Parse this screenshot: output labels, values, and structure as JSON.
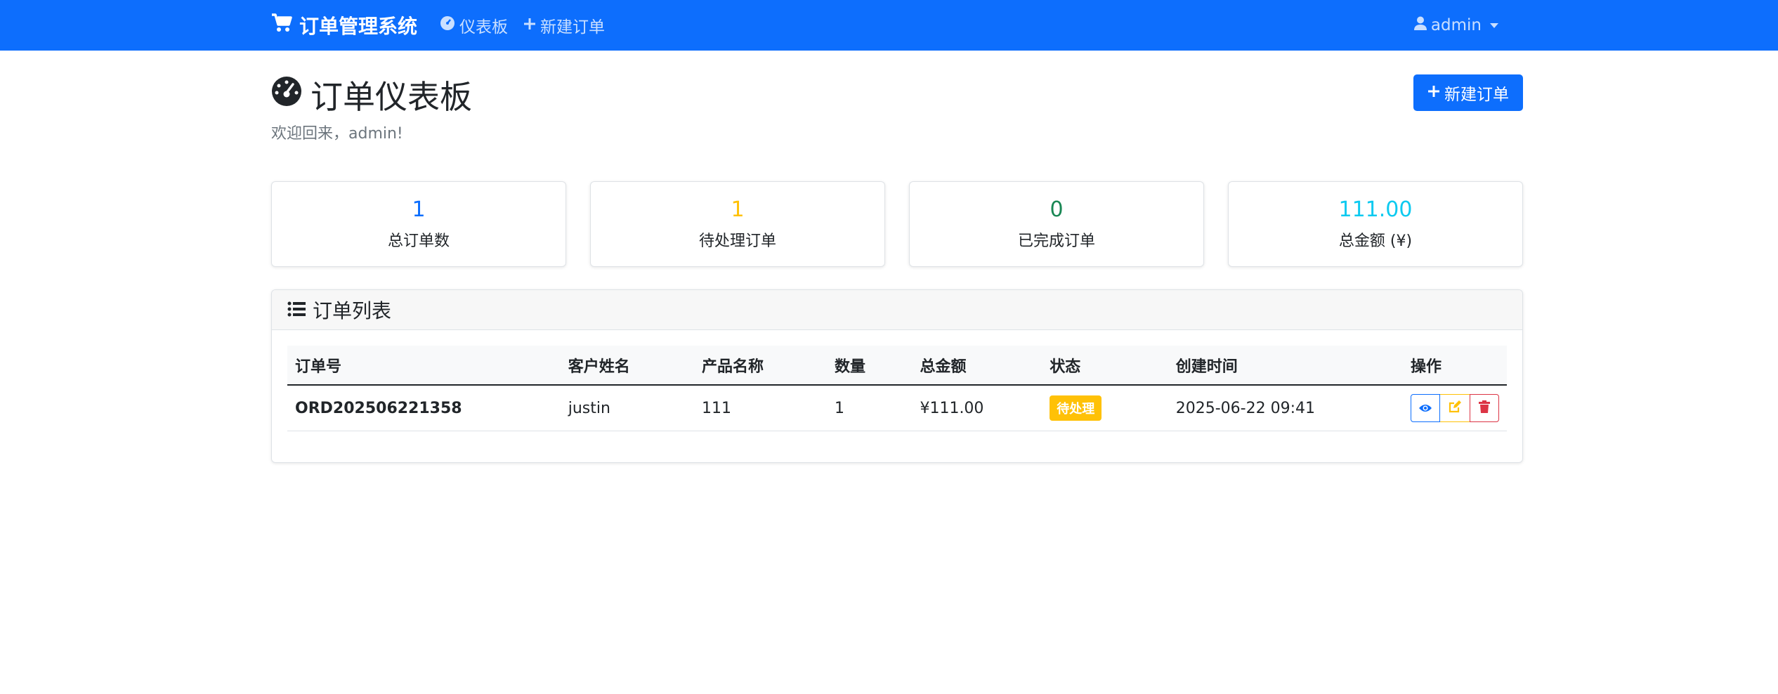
{
  "navbar": {
    "brand": "订单管理系统",
    "links": [
      {
        "label": "仪表板",
        "icon": "dashboard-icon"
      },
      {
        "label": "新建订单",
        "icon": "plus-icon"
      }
    ],
    "user": "admin"
  },
  "page": {
    "title": "订单仪表板",
    "welcome": "欢迎回来，admin!",
    "new_button": "新建订单"
  },
  "stats": [
    {
      "value": "1",
      "label": "总订单数",
      "color": "#0d6efd"
    },
    {
      "value": "1",
      "label": "待处理订单",
      "color": "#ffc107"
    },
    {
      "value": "0",
      "label": "已完成订单",
      "color": "#198754"
    },
    {
      "value": "111.00",
      "label": "总金额 (¥)",
      "color": "#0dcaf0"
    }
  ],
  "orders": {
    "header": "订单列表",
    "columns": [
      "订单号",
      "客户姓名",
      "产品名称",
      "数量",
      "总金额",
      "状态",
      "创建时间",
      "操作"
    ],
    "rows": [
      {
        "order_no": "ORD202506221358",
        "customer": "justin",
        "product": "111",
        "quantity": "1",
        "amount": "¥111.00",
        "status": "待处理",
        "created": "2025-06-22 09:41"
      }
    ]
  }
}
